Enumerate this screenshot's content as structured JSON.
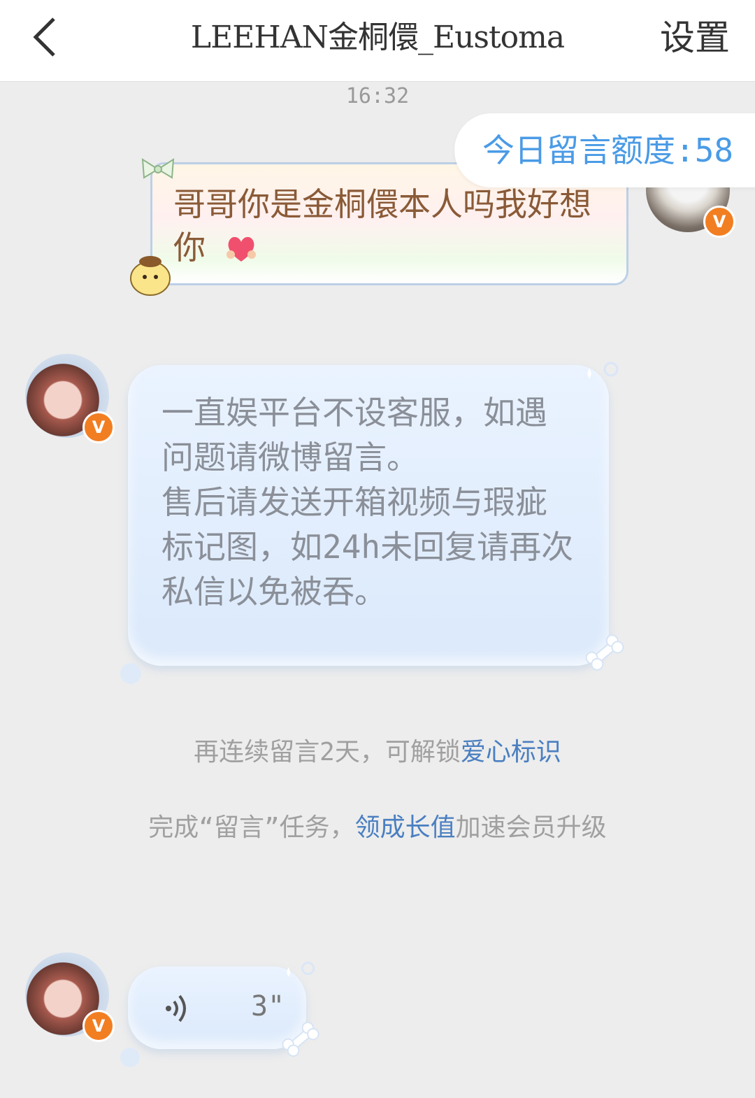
{
  "header": {
    "back_icon": "chevron-left-icon",
    "title": "LEEHAN金桐儇_Eustoma",
    "settings_label": "设置"
  },
  "chat": {
    "timestamp": "16:32",
    "quota_label": "今日留言额度:58",
    "messages": [
      {
        "side": "right",
        "text": "哥哥你是金桐儇本人吗我好想你",
        "emoji": "heart-hands-icon"
      },
      {
        "side": "left",
        "text": "一直娱平台不设客服，如遇问题请微博留言。\n售后请发送开箱视频与瑕疵标记图，如24h未回复请再次私信以免被吞。"
      },
      {
        "side": "left",
        "type": "voice",
        "duration": "3\"",
        "icon": "voice-wave-icon"
      }
    ],
    "system": [
      {
        "prefix": "再连续留言2天，可解锁",
        "link": "爱心标识",
        "suffix": ""
      },
      {
        "prefix": "完成“留言”任务，",
        "link": "领成长值",
        "suffix": "加速会员升级"
      }
    ]
  },
  "badges": {
    "verified": "V"
  }
}
